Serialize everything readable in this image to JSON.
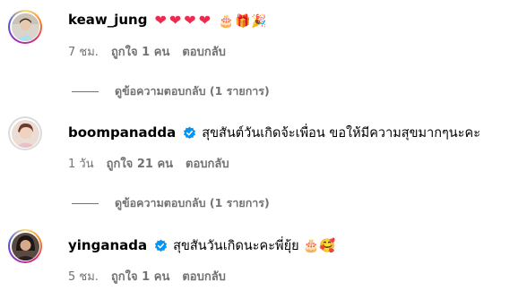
{
  "comments": [
    {
      "username": "keaw_jung",
      "verified": false,
      "text": "❤❤❤❤ 🎂🎁🎉",
      "time": "7 ชม.",
      "likes": "ถูกใจ 1 คน",
      "reply_label": "ตอบกลับ",
      "view_replies": "ดูข้อความตอบกลับ (1 รายการ)"
    },
    {
      "username": "boompanadda",
      "verified": true,
      "text": "สุขสันต์วันเกิดจ้ะเพื่อน ขอให้มีความสุขมากๆนะคะ",
      "time": "1 วัน",
      "likes": "ถูกใจ 21 คน",
      "reply_label": "ตอบกลับ",
      "view_replies": "ดูข้อความตอบกลับ (1 รายการ)"
    },
    {
      "username": "yinganada",
      "verified": true,
      "text": "สุขสันวันเกิดนะคะพี่ยุ้ย 🎂🥰",
      "time": "5 ชม.",
      "likes": "ถูกใจ 1 คน",
      "reply_label": "ตอบกลับ"
    }
  ],
  "colors": {
    "verified": "#0095f6",
    "heart": "#ed2a4f",
    "secondary_text": "#737373"
  },
  "icons": {
    "verified": "verified-badge-icon"
  }
}
